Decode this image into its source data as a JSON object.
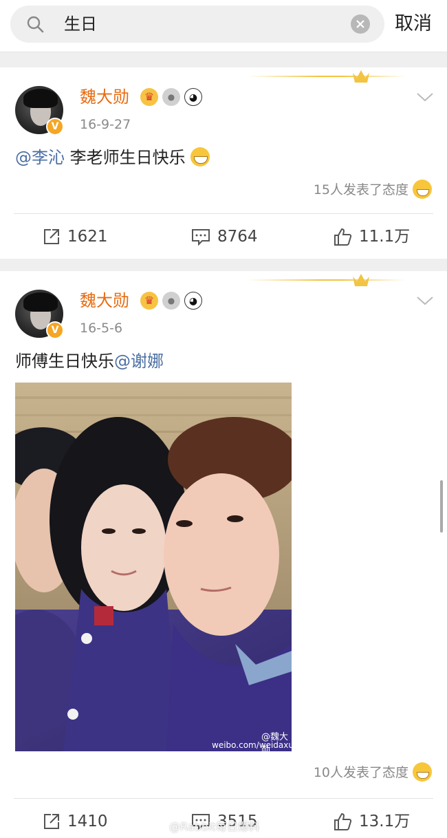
{
  "search": {
    "query": "生日",
    "cancel_label": "取消"
  },
  "posts": [
    {
      "username": "魏大勋",
      "timestamp": "16-9-27",
      "mention": "@李沁",
      "text": " 李老师生日快乐",
      "reactions_text": "15人发表了态度",
      "reposts": "1621",
      "comments": "8764",
      "likes": "11.1万"
    },
    {
      "username": "魏大勋",
      "timestamp": "16-5-6",
      "text": "师傅生日快乐",
      "mention": "@谢娜",
      "photo_watermark_logo": "@魏大勋",
      "photo_watermark_url": "weibo.com/weidaxun",
      "reactions_text": "10人发表了态度",
      "reposts": "1410",
      "comments": "3515",
      "likes": "13.1万"
    }
  ],
  "overlay_watermark": "@Rabbit每日爆料",
  "colors": {
    "username": "#e86b10",
    "mention": "#4b6fa3",
    "crown_gold": "#f2c443"
  },
  "icons": [
    "search-icon",
    "clear-icon",
    "crown-icon",
    "chevron-down-icon",
    "repost-icon",
    "comment-icon",
    "like-icon",
    "grin-emoji",
    "verified-badge"
  ]
}
